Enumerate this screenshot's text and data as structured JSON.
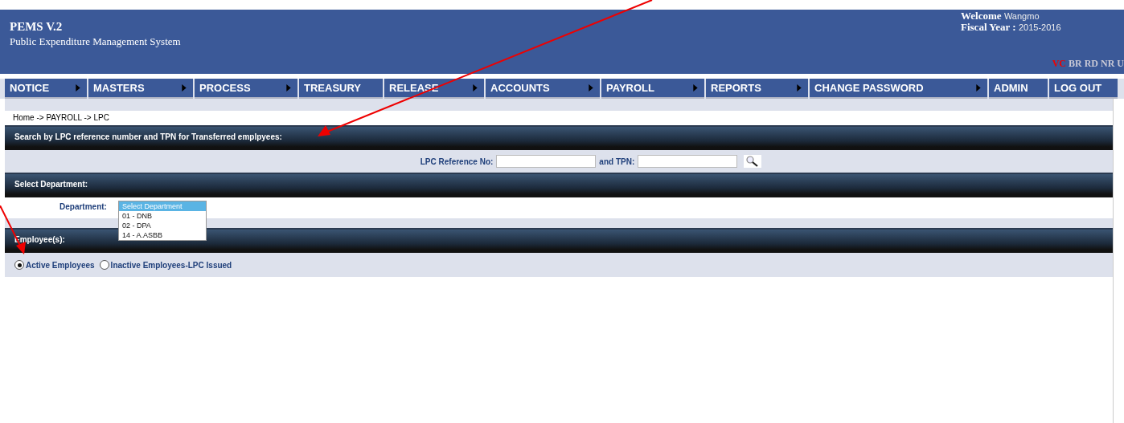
{
  "header": {
    "title": "PEMS V.2",
    "subtitle": "Public Expenditure Management System",
    "welcome_label": "Welcome",
    "user": "Wangmo",
    "fiscal_label": "Fiscal Year :",
    "fiscal_year": "2015-2016",
    "modes": [
      {
        "label": "VC",
        "selected": true
      },
      {
        "label": "BR",
        "selected": false
      },
      {
        "label": "RD",
        "selected": false
      },
      {
        "label": "NR",
        "selected": false
      },
      {
        "label": "U",
        "selected": false
      }
    ]
  },
  "menu": [
    {
      "label": "NOTICE",
      "submenu": true
    },
    {
      "label": "MASTERS",
      "submenu": true
    },
    {
      "label": "PROCESS",
      "submenu": true
    },
    {
      "label": "TREASURY",
      "submenu": false
    },
    {
      "label": "RELEASE",
      "submenu": true
    },
    {
      "label": "ACCOUNTS",
      "submenu": true
    },
    {
      "label": "PAYROLL",
      "submenu": true
    },
    {
      "label": "REPORTS",
      "submenu": true
    },
    {
      "label": "CHANGE PASSWORD",
      "submenu": true
    },
    {
      "label": "ADMIN",
      "submenu": false
    },
    {
      "label": "LOG OUT",
      "submenu": false
    }
  ],
  "breadcrumb": "Home -> PAYROLL -> LPC",
  "search_section": {
    "title": "Search by LPC reference number and TPN for Transferred emplpyees:",
    "ref_label": "LPC Reference No:",
    "tpn_label": "and TPN:"
  },
  "department_section": {
    "title": "Select Department:",
    "label": "Department:",
    "options": [
      {
        "label": "Select Department",
        "selected": true
      },
      {
        "label": "01 - DNB",
        "selected": false
      },
      {
        "label": "02 - DPA",
        "selected": false
      },
      {
        "label": "14 - A.ASBB",
        "selected": false
      }
    ]
  },
  "employees_section": {
    "title": "Employee(s):",
    "radios": [
      {
        "label": "Active Employees",
        "selected": true
      },
      {
        "label": "Inactive Employees-LPC Issued",
        "selected": false
      }
    ]
  }
}
